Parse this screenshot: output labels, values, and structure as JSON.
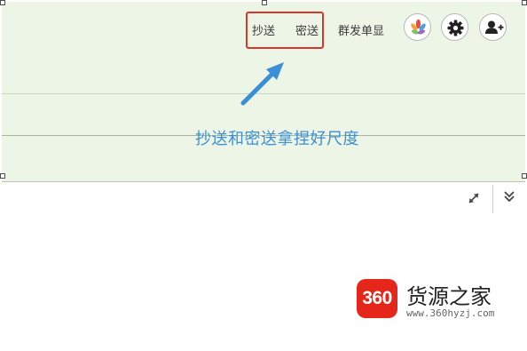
{
  "toolbar": {
    "cc_label": "抄送",
    "bcc_label": "密送",
    "separate_send_label": "群发单显",
    "app_icon_name": "colorful-leaves-icon",
    "settings_icon_name": "gear-icon",
    "add_contact_icon_name": "add-person-icon"
  },
  "annotation": {
    "text": "抄送和密送拿捏好尺度",
    "color": "#3b8fd6",
    "highlight_color": "#d6392a"
  },
  "editor": {
    "expand_icon_name": "expand-diagonal-icon",
    "collapse_icon_name": "double-chevron-down-icon"
  },
  "watermark": {
    "logo_text": "360",
    "name": "货源之家",
    "url": "www.360hyzj.com",
    "brand_color": "#e4261b"
  },
  "colors": {
    "header_bg": "#ecf5e6"
  }
}
